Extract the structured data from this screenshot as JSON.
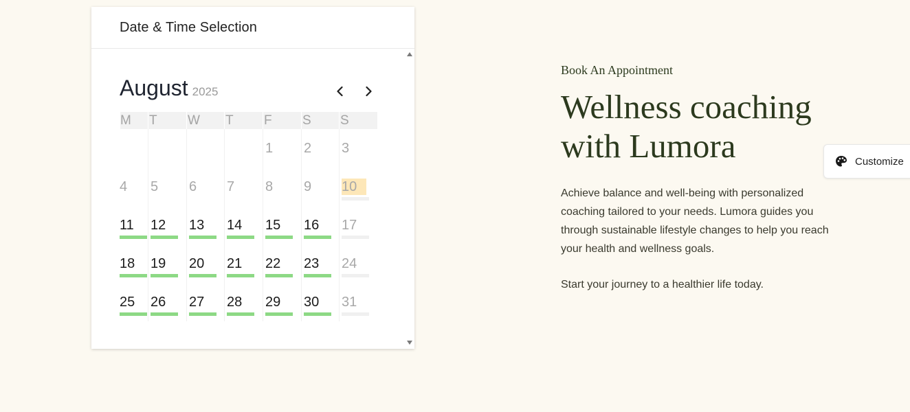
{
  "widget": {
    "title": "Date & Time Selection"
  },
  "calendar": {
    "month": "August",
    "year": "2025",
    "weekdays": [
      "M",
      "T",
      "W",
      "T",
      "F",
      "S",
      "S"
    ],
    "weeks": [
      [
        {
          "day": "",
          "state": "empty"
        },
        {
          "day": "",
          "state": "empty"
        },
        {
          "day": "",
          "state": "empty"
        },
        {
          "day": "",
          "state": "empty"
        },
        {
          "day": "1",
          "state": "unavailable"
        },
        {
          "day": "2",
          "state": "unavailable"
        },
        {
          "day": "3",
          "state": "unavailable"
        }
      ],
      [
        {
          "day": "4",
          "state": "unavailable"
        },
        {
          "day": "5",
          "state": "unavailable"
        },
        {
          "day": "6",
          "state": "unavailable"
        },
        {
          "day": "7",
          "state": "unavailable"
        },
        {
          "day": "8",
          "state": "unavailable"
        },
        {
          "day": "9",
          "state": "unavailable"
        },
        {
          "day": "10",
          "state": "today"
        }
      ],
      [
        {
          "day": "11",
          "state": "available"
        },
        {
          "day": "12",
          "state": "available"
        },
        {
          "day": "13",
          "state": "available"
        },
        {
          "day": "14",
          "state": "available"
        },
        {
          "day": "15",
          "state": "available"
        },
        {
          "day": "16",
          "state": "available"
        },
        {
          "day": "17",
          "state": "closed"
        }
      ],
      [
        {
          "day": "18",
          "state": "available"
        },
        {
          "day": "19",
          "state": "available"
        },
        {
          "day": "20",
          "state": "available"
        },
        {
          "day": "21",
          "state": "available"
        },
        {
          "day": "22",
          "state": "available"
        },
        {
          "day": "23",
          "state": "available"
        },
        {
          "day": "24",
          "state": "closed"
        }
      ],
      [
        {
          "day": "25",
          "state": "available"
        },
        {
          "day": "26",
          "state": "available"
        },
        {
          "day": "27",
          "state": "available"
        },
        {
          "day": "28",
          "state": "available"
        },
        {
          "day": "29",
          "state": "available"
        },
        {
          "day": "30",
          "state": "available"
        },
        {
          "day": "31",
          "state": "closed"
        }
      ]
    ]
  },
  "intro": {
    "eyebrow": "Book An Appointment",
    "headline": "Wellness coaching with Lumora",
    "description": "Achieve balance and well-being with personalized coaching tailored to your needs. Lumora guides you through sustainable lifestyle changes to help you reach your health and wellness goals.",
    "cta_text": "Start your journey to a healthier life today."
  },
  "customize": {
    "label": "Customize",
    "icon": "palette-icon"
  },
  "colors": {
    "page_bg": "#fcf9f1",
    "availability_bar": "#8dd985",
    "today_highlight": "#fde7b8",
    "heading_green": "#2c3a1e"
  }
}
